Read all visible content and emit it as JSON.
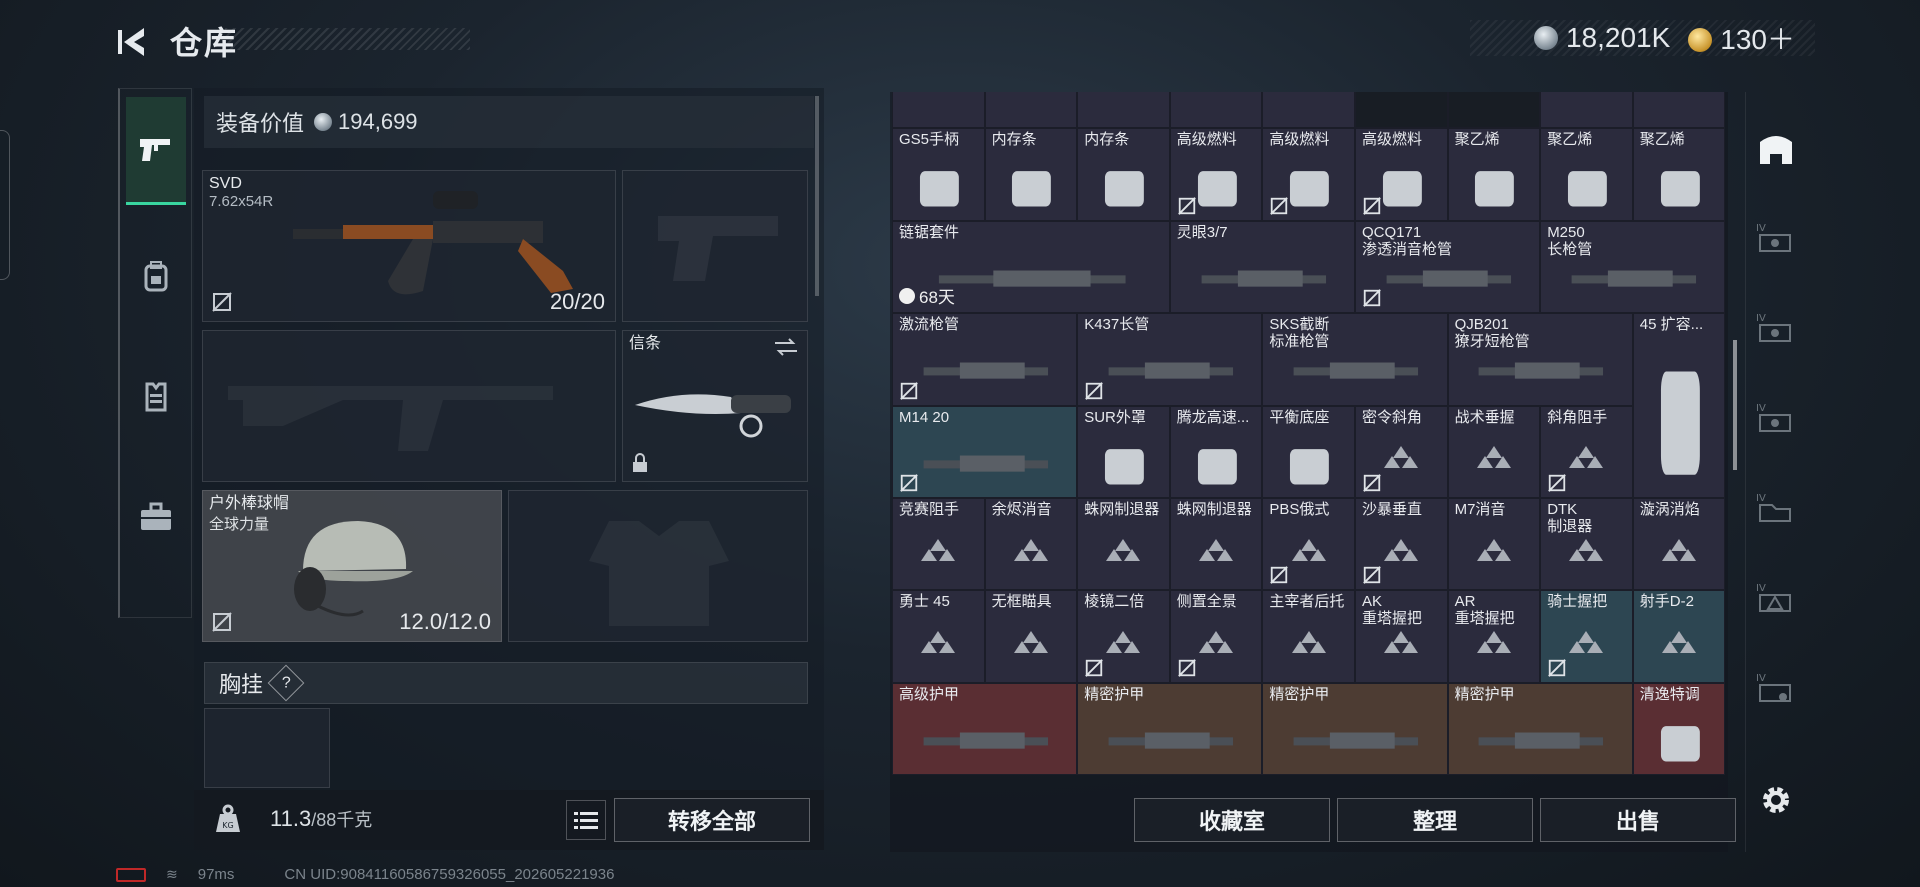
{
  "header": {
    "title": "仓库",
    "currency_silver": "18,201K",
    "currency_gold": "130＋"
  },
  "left_nav": {
    "tabs": [
      "weapon-tab",
      "backpack-tab",
      "vest-tab",
      "case-tab"
    ]
  },
  "equipment": {
    "value_label": "装备价值",
    "value": "194,699",
    "primary": {
      "name": "SVD",
      "caliber": "7.62x54R",
      "ammo": "20/20"
    },
    "knife": {
      "name": "信条"
    },
    "helmet": {
      "name": "户外棒球帽",
      "sub": "全球力量",
      "durability": "12.0/12.0"
    },
    "chest_label": "胸挂",
    "chest_help": "?"
  },
  "bottom_left": {
    "weight": "11.3",
    "weight_max": "/88千克",
    "transfer_all": "转移全部"
  },
  "grid": {
    "rows": [
      [
        {
          "label": ""
        },
        {
          "label": ""
        },
        {
          "label": ""
        },
        {
          "label": ""
        },
        {
          "label": ""
        },
        {
          "label": ""
        },
        {
          "label": ""
        },
        {
          "label": ""
        },
        {
          "label": ""
        }
      ],
      [
        {
          "label": "GS5手柄"
        },
        {
          "label": "内存条"
        },
        {
          "label": "内存条"
        },
        {
          "label": "高级燃料"
        },
        {
          "label": "高级燃料"
        },
        {
          "label": "高级燃料"
        },
        {
          "label": "聚乙烯"
        },
        {
          "label": "聚乙烯"
        },
        {
          "label": "聚乙烯"
        }
      ],
      [
        {
          "label": "链锯套件",
          "timer": "68天"
        },
        {
          "label": "灵眼3/7"
        },
        {
          "label": "QCQ171",
          "sub": "渗透消音枪管"
        },
        {
          "label": "M250",
          "sub": "长枪管"
        }
      ],
      [
        {
          "label": "激流枪管"
        },
        {
          "label": "K437长管"
        },
        {
          "label": "SKS截断",
          "sub": "标准枪管"
        },
        {
          "label": "QJB201",
          "sub": "獠牙短枪管"
        },
        {
          "label": "45 扩容..."
        }
      ],
      [
        {
          "label": "M14 20"
        },
        {
          "label": "SUR外罩"
        },
        {
          "label": "腾龙高速..."
        },
        {
          "label": "平衡底座"
        },
        {
          "label": "密令斜角"
        },
        {
          "label": "战术垂握"
        },
        {
          "label": "斜角阻手"
        }
      ],
      [
        {
          "label": "竞赛阻手"
        },
        {
          "label": "余烬消音"
        },
        {
          "label": "蛛网制退器"
        },
        {
          "label": "蛛网制退器"
        },
        {
          "label": "PBS俄式"
        },
        {
          "label": "沙暴垂直"
        },
        {
          "label": "M7消音"
        },
        {
          "label": "DTK",
          "sub": "制退器"
        },
        {
          "label": "漩涡消焰"
        }
      ],
      [
        {
          "label": "勇士 45"
        },
        {
          "label": "无框瞄具"
        },
        {
          "label": "棱镜二倍"
        },
        {
          "label": "侧置全景"
        },
        {
          "label": "主宰者后托"
        },
        {
          "label": "AK",
          "sub": "重塔握把"
        },
        {
          "label": "AR",
          "sub": "重塔握把"
        },
        {
          "label": "骑士握把"
        },
        {
          "label": "射手D-2"
        }
      ],
      [
        {
          "label": "高级护甲"
        },
        {
          "label": "精密护甲"
        },
        {
          "label": "精密护甲"
        },
        {
          "label": "精密护甲"
        },
        {
          "label": "清逸特调"
        }
      ]
    ]
  },
  "grid_actions": {
    "collection": "收藏室",
    "sort": "整理",
    "sell": "出售"
  },
  "status": {
    "ping": "97ms",
    "uid": "CN UID:9084116058675932605​5_202605221936"
  },
  "colors": {
    "accent": "#39d6a0",
    "cell": "#2b2b3d",
    "cell_blue": "#2d4652",
    "cell_red": "#5a2e33"
  }
}
